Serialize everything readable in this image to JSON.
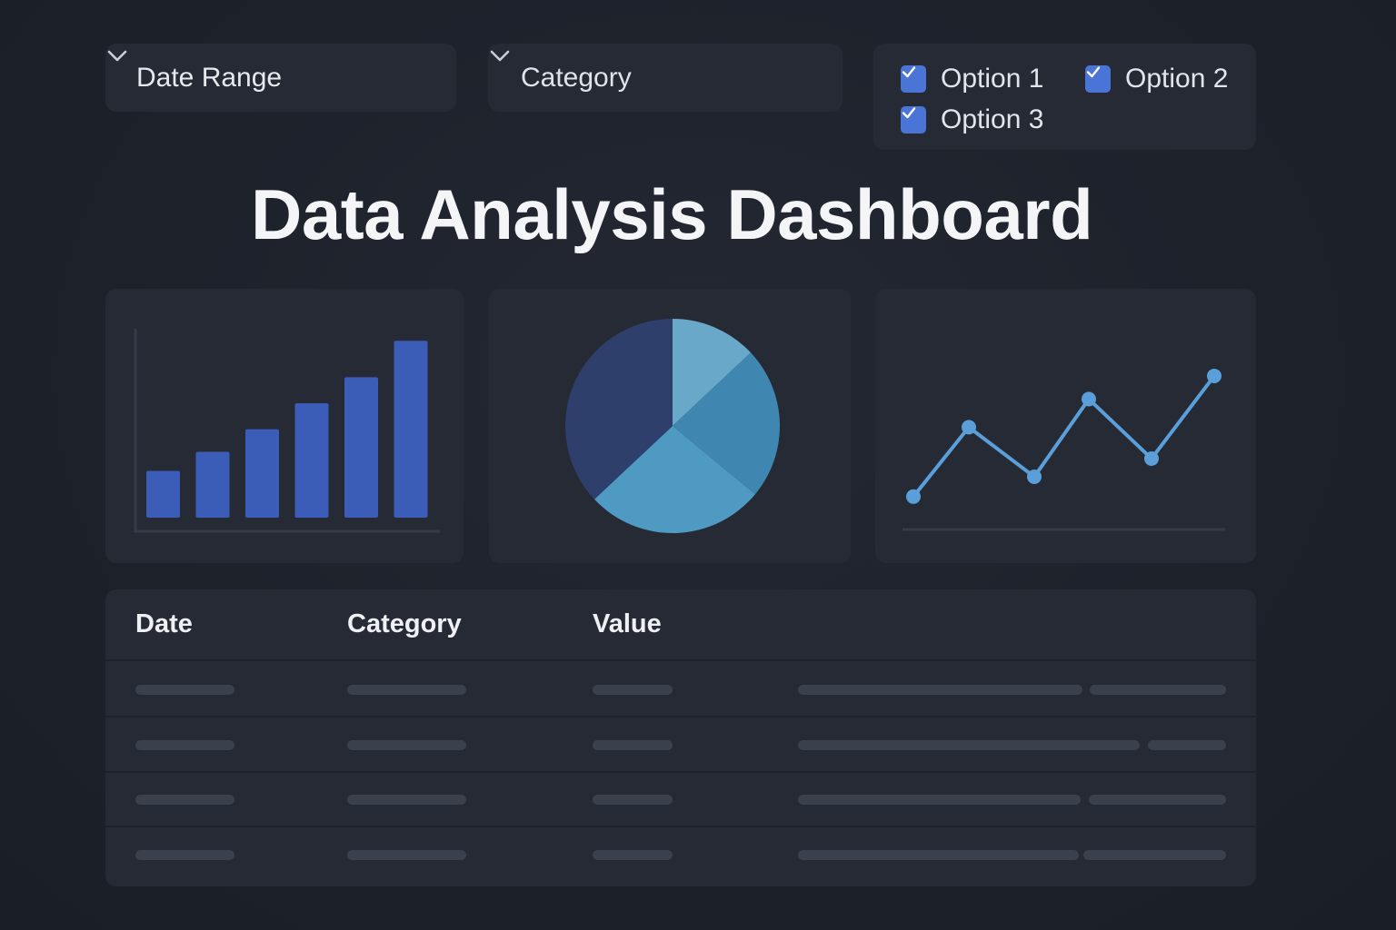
{
  "filters": {
    "date_range": {
      "label": "Date Range",
      "icon": "chevron-down-icon"
    },
    "category": {
      "label": "Category",
      "icon": "chevron-down-icon"
    },
    "options": [
      {
        "label": "Option 1",
        "checked": true
      },
      {
        "label": "Option 2",
        "checked": true
      },
      {
        "label": "Option 3",
        "checked": true
      }
    ]
  },
  "page": {
    "title": "Data Analysis Dashboard"
  },
  "colors": {
    "background": "#1d212a",
    "panel": "#252a35",
    "accent": "#4a74d6",
    "bar": "#3b5db8",
    "line": "#5a9fd9",
    "pie": [
      "#6aa8c9",
      "#3f86b0",
      "#4e9ac2",
      "#2f3f6b"
    ],
    "placeholder": "#3a404c"
  },
  "chart_data": [
    {
      "type": "bar",
      "values": [
        27,
        38,
        51,
        66,
        81,
        102
      ],
      "ylim": [
        0,
        110
      ]
    },
    {
      "type": "pie",
      "values": [
        13,
        23,
        27,
        37
      ]
    },
    {
      "type": "line",
      "values": [
        10,
        52,
        22,
        69,
        33,
        83
      ],
      "ylim": [
        0,
        100
      ]
    }
  ],
  "table": {
    "headers": [
      "Date",
      "Category",
      "Value"
    ],
    "row_count": 4
  }
}
